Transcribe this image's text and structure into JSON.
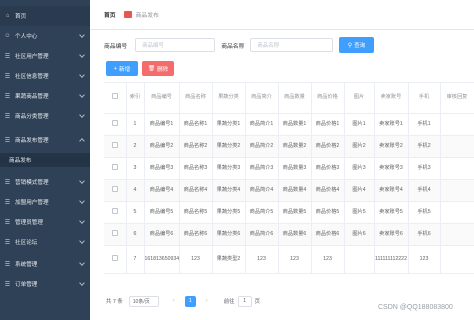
{
  "sidebar": {
    "items": [
      {
        "label": "首页",
        "icon": "home-icon"
      },
      {
        "label": "个人中心",
        "icon": "user-icon"
      },
      {
        "label": "社区用户管理",
        "icon": "users-icon"
      },
      {
        "label": "社区信息管理",
        "icon": "info-icon"
      },
      {
        "label": "果蔬商品管理",
        "icon": "goods-icon"
      },
      {
        "label": "商品分类管理",
        "icon": "category-icon"
      },
      {
        "label": "商品发布管理",
        "icon": "publish-icon"
      },
      {
        "label": "营销模式管理",
        "icon": "marketing-icon"
      },
      {
        "label": "加盟用户管理",
        "icon": "franchise-icon"
      },
      {
        "label": "管理员管理",
        "icon": "admin-icon"
      },
      {
        "label": "社区论坛",
        "icon": "forum-icon"
      },
      {
        "label": "系统管理",
        "icon": "system-icon"
      },
      {
        "label": "订单管理",
        "icon": "order-icon"
      }
    ],
    "subitem": "商品发布"
  },
  "breadcrumb": {
    "home": "首页",
    "current": "商品发布"
  },
  "search": {
    "label1": "商品编号",
    "placeholder1": "商品编号",
    "label2": "商品名称",
    "placeholder2": "商品名称",
    "button": "查询"
  },
  "actions": {
    "add": "新增",
    "delete": "删除"
  },
  "table": {
    "headers": [
      "",
      "索引",
      "商品编号",
      "商品名称",
      "果蔬分类",
      "商品简介",
      "商品数量",
      "商品价格",
      "图片",
      "卖家账号",
      "手机",
      "审核回复"
    ],
    "rows": [
      [
        "1",
        "商品编号1",
        "商品名称1",
        "果蔬分类1",
        "商品简介1",
        "商品数量1",
        "商品价格1",
        "图片1",
        "卖家账号1",
        "手机1",
        ""
      ],
      [
        "2",
        "商品编号2",
        "商品名称2",
        "果蔬分类2",
        "商品简介2",
        "商品数量2",
        "商品价格2",
        "图片2",
        "卖家账号2",
        "手机2",
        ""
      ],
      [
        "3",
        "商品编号3",
        "商品名称3",
        "果蔬分类3",
        "商品简介3",
        "商品数量3",
        "商品价格3",
        "图片3",
        "卖家账号3",
        "手机3",
        ""
      ],
      [
        "4",
        "商品编号4",
        "商品名称4",
        "果蔬分类4",
        "商品简介4",
        "商品数量4",
        "商品价格4",
        "图片4",
        "卖家账号4",
        "手机4",
        ""
      ],
      [
        "5",
        "商品编号5",
        "商品名称5",
        "果蔬分类5",
        "商品简介5",
        "商品数量5",
        "商品价格5",
        "图片5",
        "卖家账号5",
        "手机5",
        ""
      ],
      [
        "6",
        "商品编号6",
        "商品名称6",
        "果蔬分类6",
        "商品简介6",
        "商品数量6",
        "商品价格6",
        "图片6",
        "卖家账号6",
        "手机6",
        ""
      ],
      [
        "7",
        "1618136509346",
        "123",
        "果蔬类型2",
        "123",
        "123",
        "123",
        "",
        "111111112222",
        "123",
        ""
      ]
    ]
  },
  "pagination": {
    "total": "共 7 条",
    "page_size": "10条/页",
    "current": "1",
    "goto": "前往",
    "page_input": "1",
    "page_suffix": "页"
  },
  "watermark": "CSDN @QQ188083800",
  "colors": {
    "sidebar": "#2f4156",
    "primary": "#409eff",
    "danger": "#f56c6c"
  }
}
